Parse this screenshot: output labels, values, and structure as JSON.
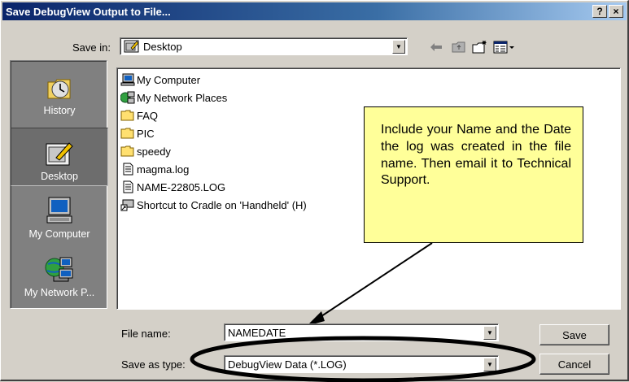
{
  "dialog": {
    "title": "Save DebugView Output to File...",
    "help_label": "?",
    "close_label": "×"
  },
  "save_in": {
    "label": "Save in:",
    "value": "Desktop"
  },
  "places": [
    {
      "label": "History",
      "icon": "history-icon"
    },
    {
      "label": "Desktop",
      "icon": "desktop-icon",
      "active": true
    },
    {
      "label": "My Computer",
      "icon": "my-computer-icon"
    },
    {
      "label": "My Network P...",
      "icon": "network-icon"
    }
  ],
  "files": [
    {
      "name": "My Computer",
      "icon": "computer-icon"
    },
    {
      "name": "My Network Places",
      "icon": "network-icon"
    },
    {
      "name": "FAQ",
      "icon": "folder-icon"
    },
    {
      "name": "PIC",
      "icon": "folder-icon"
    },
    {
      "name": "speedy",
      "icon": "folder-icon"
    },
    {
      "name": "magma.log",
      "icon": "text-file-icon"
    },
    {
      "name": "NAME-22805.LOG",
      "icon": "text-file-icon"
    },
    {
      "name": "Shortcut to Cradle on 'Handheld' (H)",
      "icon": "shortcut-icon"
    }
  ],
  "file_name": {
    "label": "File name:",
    "value": "NAMEDATE"
  },
  "save_as_type": {
    "label": "Save as type:",
    "value": "DebugView Data (*.LOG)"
  },
  "buttons": {
    "save": "Save",
    "cancel": "Cancel"
  },
  "callout": {
    "text": "Include your Name and the Date the log was created in the file name. Then email it to Technical Support."
  },
  "colors": {
    "callout_bg": "#ffff99",
    "titlebar": "#0a246a",
    "face": "#d4d0c8"
  }
}
